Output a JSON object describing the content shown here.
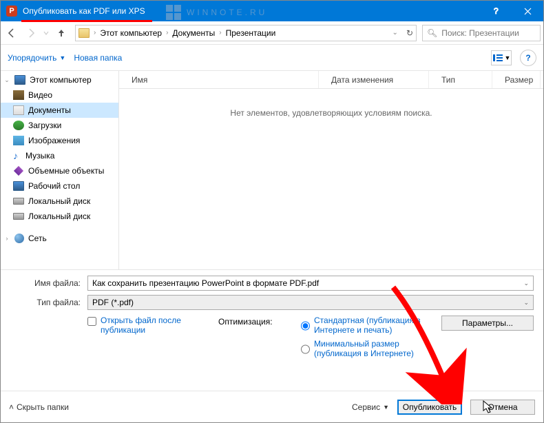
{
  "window": {
    "title": "Опубликовать как PDF или XPS"
  },
  "watermark": "WINNOTE.RU",
  "breadcrumbs": {
    "items": [
      "Этот компьютер",
      "Документы",
      "Презентации"
    ]
  },
  "search": {
    "placeholder": "Поиск: Презентации"
  },
  "toolbar": {
    "organize": "Упорядочить",
    "new_folder": "Новая папка"
  },
  "tree": {
    "root": "Этот компьютер",
    "items": [
      {
        "label": "Видео",
        "icon": "film"
      },
      {
        "label": "Документы",
        "icon": "doc",
        "selected": true
      },
      {
        "label": "Загрузки",
        "icon": "down"
      },
      {
        "label": "Изображения",
        "icon": "img"
      },
      {
        "label": "Музыка",
        "icon": "music"
      },
      {
        "label": "Объемные объекты",
        "icon": "cube"
      },
      {
        "label": "Рабочий стол",
        "icon": "monitor"
      },
      {
        "label": "Локальный диск",
        "icon": "drive"
      },
      {
        "label": "Локальный диск",
        "icon": "drive"
      }
    ],
    "network": "Сеть"
  },
  "list": {
    "columns": {
      "name": "Имя",
      "date": "Дата изменения",
      "type": "Тип",
      "size": "Размер"
    },
    "empty": "Нет элементов, удовлетворяющих условиям поиска."
  },
  "fields": {
    "filename_label": "Имя файла:",
    "filename_value": "Как сохранить презентацию PowerPoint в формате PDF.pdf",
    "filetype_label": "Тип файла:",
    "filetype_value": "PDF (*.pdf)"
  },
  "options": {
    "open_after": "Открыть файл после публикации",
    "optimization_label": "Оптимизация:",
    "standard": "Стандартная (публикация в Интернете и печать)",
    "minimal": "Минимальный размер (публикация в Интернете)",
    "params_btn": "Параметры..."
  },
  "footer": {
    "hide_folders": "Скрыть папки",
    "tools": "Сервис",
    "publish": "Опубликовать",
    "cancel": "Отмена"
  }
}
